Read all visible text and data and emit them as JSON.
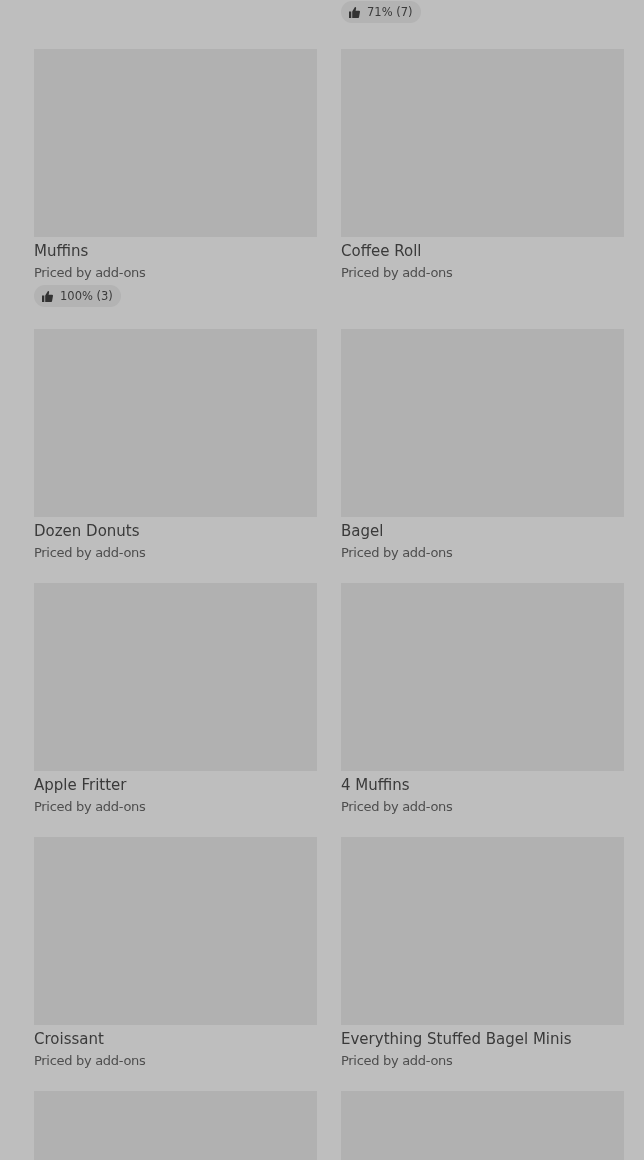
{
  "cut_off_row": {
    "column_2": {
      "rating": "71% (7)"
    }
  },
  "products": [
    {
      "kind": "card",
      "name": "Muffins",
      "price": "Priced by add-ons",
      "rating": "100% (3)"
    },
    {
      "kind": "card",
      "name": "Coffee Roll",
      "price": "Priced by add-ons"
    },
    {
      "kind": "card",
      "name": "Dozen Donuts",
      "price": "Priced by add-ons"
    },
    {
      "kind": "card",
      "name": "Bagel",
      "price": "Priced by add-ons"
    },
    {
      "kind": "card",
      "name": "Apple Fritter",
      "price": "Priced by add-ons"
    },
    {
      "kind": "card",
      "name": "4 Muffins",
      "price": "Priced by add-ons"
    },
    {
      "kind": "card",
      "name": "Croissant",
      "price": "Priced by add-ons"
    },
    {
      "kind": "card",
      "name": "Everything Stuffed Bagel Minis",
      "price": "Priced by add-ons"
    },
    {
      "kind": "cut"
    },
    {
      "kind": "cut"
    }
  ]
}
